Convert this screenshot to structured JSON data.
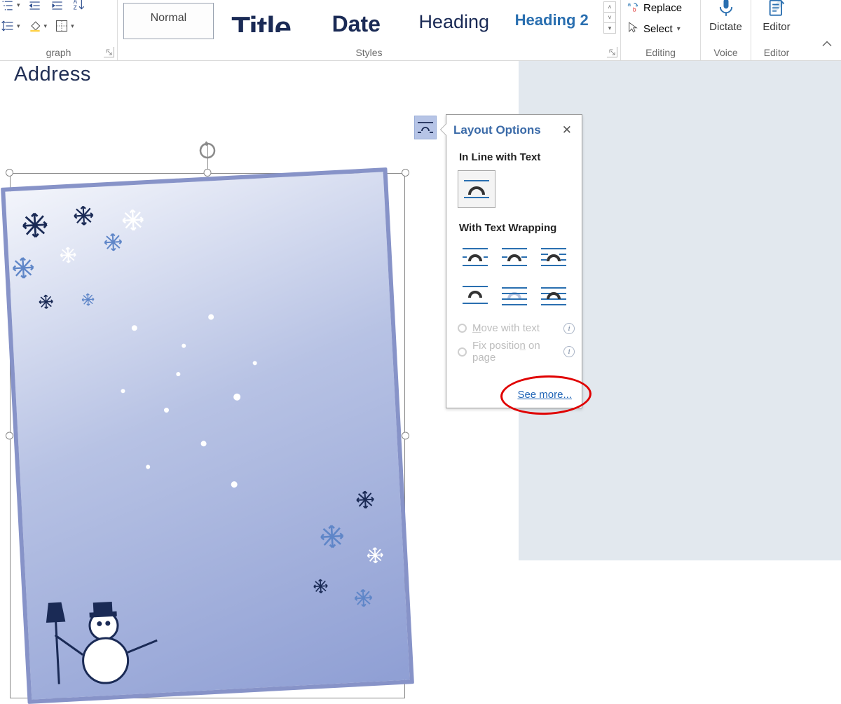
{
  "ribbon": {
    "paragraph": {
      "label": "graph"
    },
    "styles": {
      "label": "Styles",
      "items": [
        {
          "name": "Normal",
          "preview": ""
        },
        {
          "name": "",
          "preview": "Title"
        },
        {
          "name": "",
          "preview": "Date"
        },
        {
          "name": "",
          "preview": "Heading"
        },
        {
          "name": "",
          "preview": "Heading 2"
        }
      ]
    },
    "editing": {
      "label": "Editing",
      "replace": "Replace",
      "select": "Select"
    },
    "voice": {
      "label": "Voice",
      "button": "Dictate"
    },
    "editor": {
      "label": "Editor",
      "button": "Editor"
    }
  },
  "document": {
    "address_label": "Address"
  },
  "layout_options": {
    "title": "Layout Options",
    "section_inline": "In Line with Text",
    "section_wrap": "With Text Wrapping",
    "move_with_text": "ove with text",
    "move_with_text_prefix": "M",
    "fix_position": "Fix positio",
    "fix_position_underlined": "n",
    "fix_position_suffix": " on page",
    "see_more": "See more..."
  }
}
